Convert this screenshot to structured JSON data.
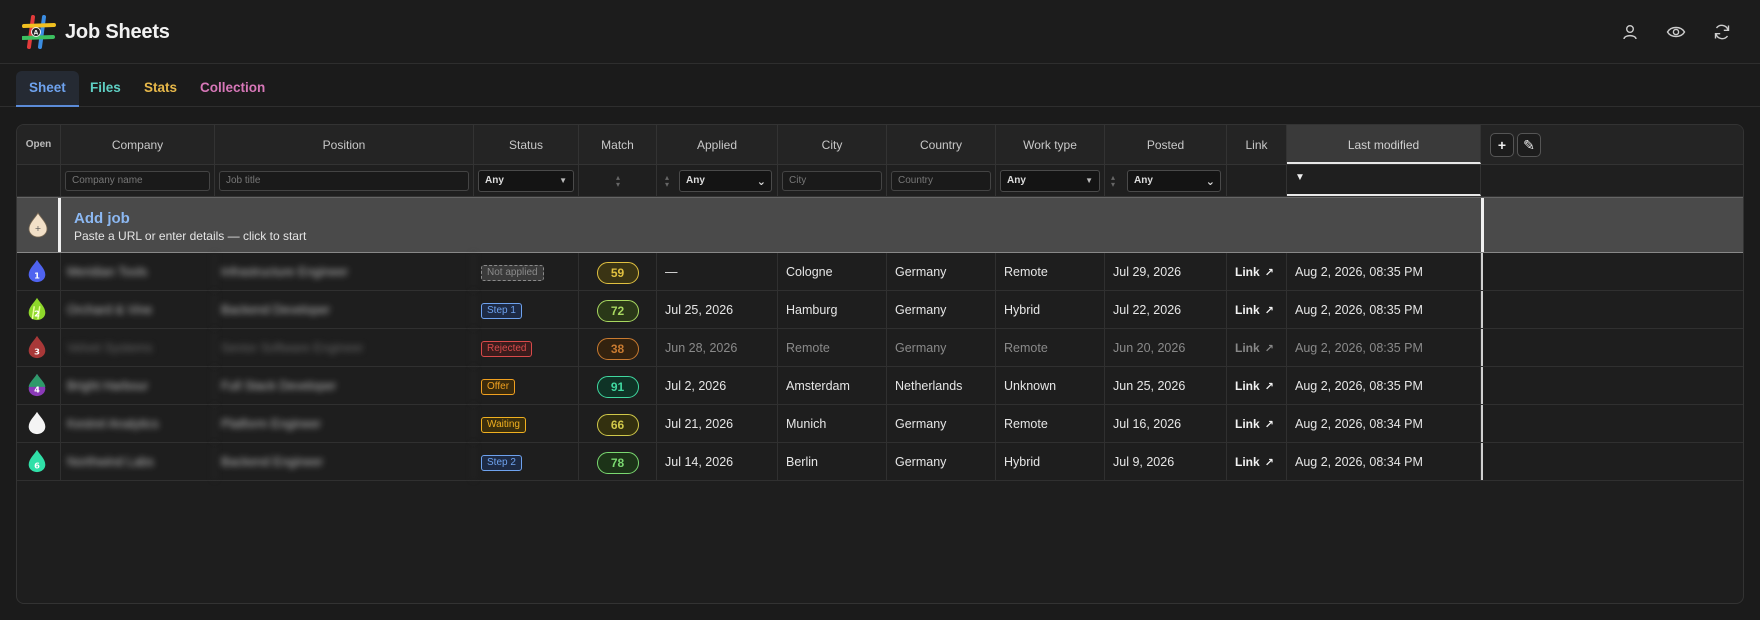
{
  "app": {
    "title": "Job Sheets",
    "logo": "hash-logo-icon"
  },
  "header_icons": [
    "user-icon",
    "eye-icon",
    "refresh-icon"
  ],
  "tabs": [
    {
      "label": "Sheet",
      "color": "#6ea2ee",
      "active": true
    },
    {
      "label": "Files",
      "color": "#5fd0c4"
    },
    {
      "label": "Stats",
      "color": "#e7b84a"
    },
    {
      "label": "Collection",
      "color": "#d777b8"
    }
  ],
  "columns": {
    "open": "Open",
    "company": "Company",
    "position": "Position",
    "status": "Status",
    "match": "Match",
    "applied": "Applied",
    "city": "City",
    "country": "Country",
    "work_type": "Work type",
    "posted": "Posted",
    "link": "Link",
    "last_modified": "Last modified"
  },
  "filters": {
    "company_placeholder": "Company name",
    "position_placeholder": "Job title",
    "status": "Any",
    "applied": "Any",
    "city_placeholder": "City",
    "country_placeholder": "Country",
    "work_type": "Any",
    "posted": "Any",
    "last_modified_sort": "▼"
  },
  "add_job": {
    "title": "Add job",
    "subtitle": "Paste a URL or enter details — click to start",
    "icon_text": "+"
  },
  "rows": [
    {
      "num": "1",
      "icon_color": "#4f63f0",
      "company": "Meridian Tools",
      "position": "Infrastructure Engineer",
      "status": "Not applied",
      "status_color": "#8a8a8a",
      "status_bg": "#3a3a3a",
      "status_style": "dashed",
      "match": "59",
      "match_color": "#e0c040",
      "match_bg": "#3a3414",
      "applied": "—",
      "city": "Cologne",
      "country": "Germany",
      "work_type": "Remote",
      "posted": "Jul 29, 2026",
      "link": "Link",
      "last_modified": "Aug 2, 2026, 08:35 PM",
      "dim": false
    },
    {
      "num": "2",
      "icon_color": "#8ed82a",
      "icon_stripes": true,
      "company": "Orchard & Vine",
      "position": "Backend Developer",
      "status": "Step 1",
      "status_color": "#6ea2ee",
      "status_bg": "#1d2a44",
      "match": "72",
      "match_color": "#a8d860",
      "match_bg": "#2a3818",
      "applied": "Jul 25, 2026",
      "city": "Hamburg",
      "country": "Germany",
      "work_type": "Hybrid",
      "posted": "Jul 22, 2026",
      "link": "Link",
      "last_modified": "Aug 2, 2026, 08:35 PM",
      "dim": false
    },
    {
      "num": "3",
      "icon_color": "#a83838",
      "company": "Velvet Systems",
      "position": "Senior Software Engineer",
      "status": "Rejected",
      "status_color": "#d94a4a",
      "status_bg": "#3a1c1c",
      "match": "38",
      "match_color": "#c87a30",
      "match_bg": "#33220f",
      "applied": "Jun 28, 2026",
      "city": "Remote",
      "country": "Germany",
      "work_type": "Remote",
      "posted": "Jun 20, 2026",
      "link": "Link",
      "last_modified": "Aug 2, 2026, 08:35 PM",
      "dim": true
    },
    {
      "num": "4",
      "icon_color": "#8a3ab8",
      "icon_top": "#2e9a6a",
      "company": "Bright Harbour",
      "position": "Full Stack Developer",
      "status": "Offer",
      "status_color": "#f0a020",
      "status_bg": "#3a2a0c",
      "match": "91",
      "match_color": "#40d8a0",
      "match_bg": "#0f3326",
      "applied": "Jul 2, 2026",
      "city": "Amsterdam",
      "country": "Netherlands",
      "work_type": "Unknown",
      "posted": "Jun 25, 2026",
      "link": "Link",
      "last_modified": "Aug 2, 2026, 08:35 PM",
      "dim": false
    },
    {
      "num": "",
      "icon_color": "#f4f4f4",
      "company": "Kestrel Analytics",
      "position": "Platform Engineer",
      "status": "Waiting",
      "status_color": "#f0b020",
      "status_bg": "#3a2e0c",
      "match": "66",
      "match_color": "#d0c84a",
      "match_bg": "#33300f",
      "applied": "Jul 21, 2026",
      "city": "Munich",
      "country": "Germany",
      "work_type": "Remote",
      "posted": "Jul 16, 2026",
      "link": "Link",
      "last_modified": "Aug 2, 2026, 08:34 PM",
      "dim": false
    },
    {
      "num": "6",
      "icon_color": "#30e0a8",
      "company": "Northwind Labs",
      "position": "Backend Engineer",
      "status": "Step 2",
      "status_color": "#6ea2ee",
      "status_bg": "#1d2a44",
      "match": "78",
      "match_color": "#7ad870",
      "match_bg": "#1c3318",
      "applied": "Jul 14, 2026",
      "city": "Berlin",
      "country": "Germany",
      "work_type": "Hybrid",
      "posted": "Jul 9, 2026",
      "link": "Link",
      "last_modified": "Aug 2, 2026, 08:34 PM",
      "dim": false
    }
  ],
  "corner_buttons": {
    "add": "+",
    "edit": "✎"
  }
}
